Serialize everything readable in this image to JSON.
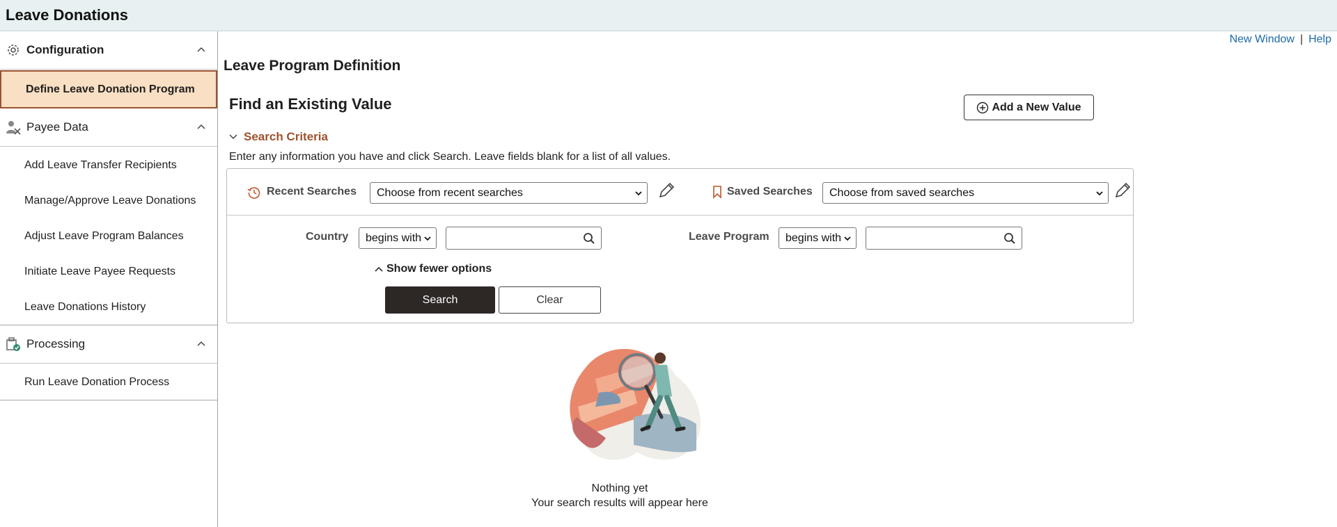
{
  "banner": {
    "title": "Leave Donations"
  },
  "sidebar": {
    "groups": [
      {
        "label": "Configuration",
        "icon": "gear-icon"
      },
      {
        "label": "Payee Data",
        "icon": "payee-icon"
      },
      {
        "label": "Processing",
        "icon": "processing-icon"
      }
    ],
    "items": {
      "define": "Define Leave Donation Program",
      "add_recipients": "Add Leave Transfer Recipients",
      "manage": "Manage/Approve Leave Donations",
      "adjust": "Adjust Leave Program Balances",
      "initiate": "Initiate Leave Payee Requests",
      "history": "Leave Donations History",
      "run": "Run Leave Donation Process"
    }
  },
  "toplinks": {
    "new_window": "New Window",
    "separator": "|",
    "help": "Help"
  },
  "main": {
    "page_title": "Leave Program Definition",
    "find_title": "Find an Existing Value",
    "add_button": "Add a New Value",
    "criteria_header": "Search Criteria",
    "instructions": "Enter any information you have and click Search. Leave fields blank for a list of all values.",
    "recent_label": "Recent Searches",
    "recent_value": "Choose from recent searches",
    "saved_label": "Saved Searches",
    "saved_value": "Choose from saved searches",
    "country_label": "Country",
    "country_op": "begins with",
    "country_value": "",
    "program_label": "Leave Program",
    "program_op": "begins with",
    "program_value": "",
    "fewer_options": "Show fewer options",
    "search_button": "Search",
    "clear_button": "Clear",
    "empty_title": "Nothing yet",
    "empty_sub": "Your search results will appear here"
  },
  "colors": {
    "accent": "#a0522d",
    "active_bg": "#f9dfc3",
    "link": "#1c6aa8",
    "banner_bg": "#e8f1f1"
  }
}
